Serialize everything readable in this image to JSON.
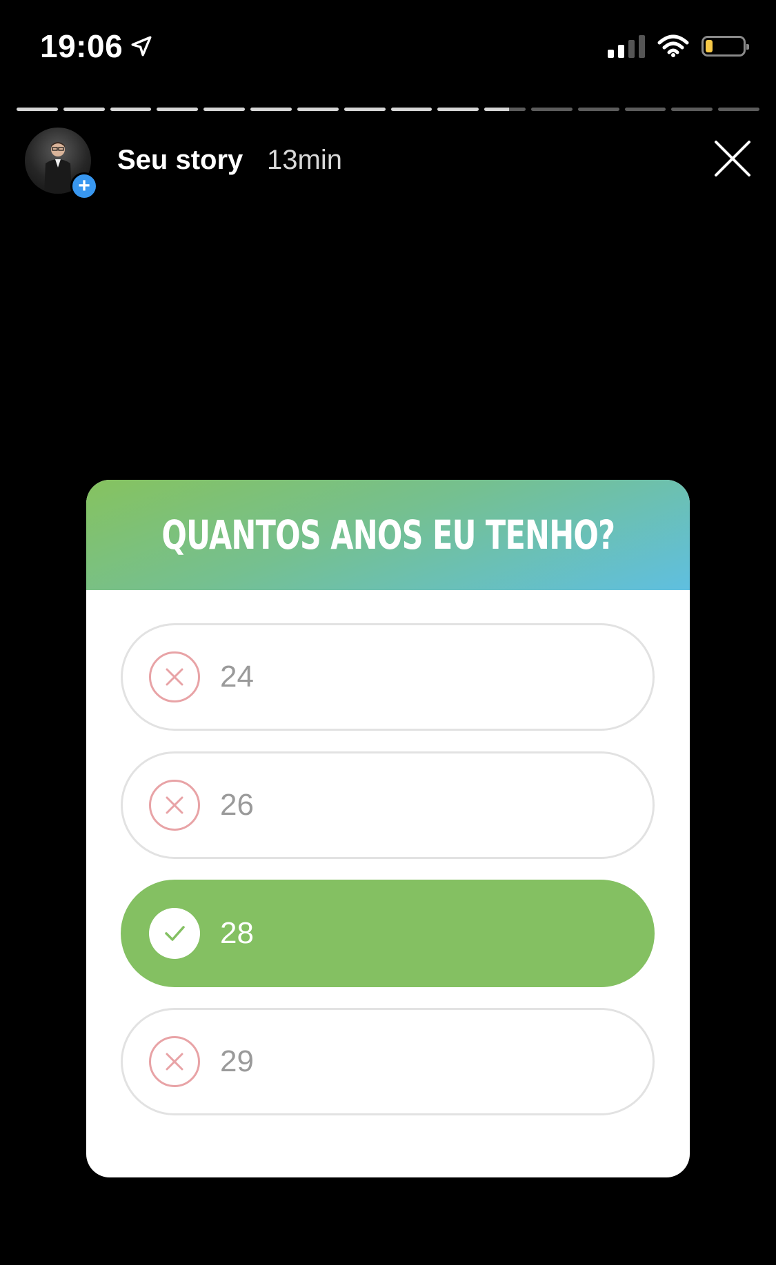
{
  "status_bar": {
    "time": "19:06",
    "battery_level": 0.2
  },
  "story": {
    "progress": {
      "total_segments": 16,
      "current_segment": 11,
      "current_fraction": 0.6
    },
    "owner": "Seu story",
    "time_ago": "13min",
    "colors": {
      "add_badge": "#3897f0"
    }
  },
  "quiz": {
    "question": "QUANTOS ANOS EU TENHO?",
    "header_gradient": [
      "#86c25f",
      "#5fbfe0"
    ],
    "correct_color": "#84c062",
    "wrong_color": "#e8a3a6",
    "options": [
      {
        "label": "24",
        "state": "wrong",
        "icon": "x-circle-icon"
      },
      {
        "label": "26",
        "state": "wrong",
        "icon": "x-circle-icon"
      },
      {
        "label": "28",
        "state": "correct",
        "icon": "check-circle-icon"
      },
      {
        "label": "29",
        "state": "wrong",
        "icon": "x-circle-icon"
      }
    ]
  }
}
